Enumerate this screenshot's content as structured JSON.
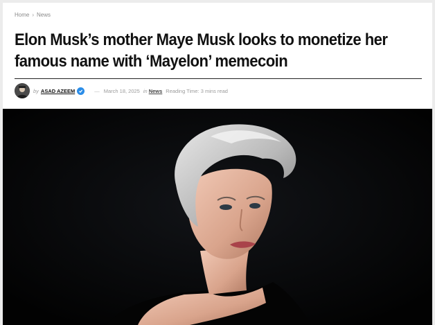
{
  "breadcrumb": {
    "home": "Home",
    "separator": "›",
    "section": "News"
  },
  "article": {
    "title": "Elon Musk’s mother Maye Musk looks to monetize her famous name with ‘Mayelon’ memecoin",
    "by_label": "by",
    "author": "ASAD AZEEM",
    "dash": "—",
    "date": "March 18, 2025",
    "in_label": "in",
    "category": "News",
    "reading_time": "Reading Time: 3 mins read"
  },
  "hero_image": {
    "subject": "portrait of Maye Musk with silver hair on black background"
  },
  "colors": {
    "verified_badge": "#2b8de8",
    "title_text": "#111111",
    "meta_text": "#9b9b9b"
  }
}
